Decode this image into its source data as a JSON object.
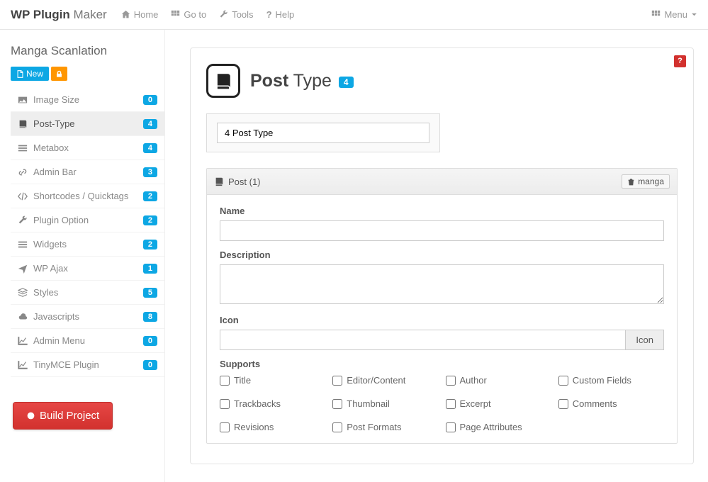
{
  "brand_bold": "WP Plugin",
  "brand_light": " Maker",
  "topnav": {
    "home": "Home",
    "goto": "Go to",
    "tools": "Tools",
    "help": "Help",
    "menu": "Menu"
  },
  "project_name": "Manga Scanlation",
  "btn_new": "New",
  "sidebar": {
    "items": [
      {
        "label": "Image Size",
        "count": "0"
      },
      {
        "label": "Post-Type",
        "count": "4"
      },
      {
        "label": "Metabox",
        "count": "4"
      },
      {
        "label": "Admin Bar",
        "count": "3"
      },
      {
        "label": "Shortcodes / Quicktags",
        "count": "2"
      },
      {
        "label": "Plugin Option",
        "count": "2"
      },
      {
        "label": "Widgets",
        "count": "2"
      },
      {
        "label": "WP Ajax",
        "count": "1"
      },
      {
        "label": "Styles",
        "count": "5"
      },
      {
        "label": "Javascripts",
        "count": "8"
      },
      {
        "label": "Admin Menu",
        "count": "0"
      },
      {
        "label": "TinyMCE Plugin",
        "count": "0"
      }
    ]
  },
  "build_label": "Build Project",
  "page": {
    "title_bold": "Post",
    "title_light": " Type",
    "badge": "4",
    "help": "?",
    "summary_value": "4 Post Type"
  },
  "panel": {
    "title": "Post (1)",
    "delete_label": "manga",
    "fields": {
      "name_label": "Name",
      "name_value": "",
      "desc_label": "Description",
      "desc_value": "",
      "icon_label": "Icon",
      "icon_value": "",
      "icon_button": "Icon",
      "supports_label": "Supports"
    },
    "supports": [
      "Title",
      "Editor/Content",
      "Author",
      "Custom Fields",
      "Trackbacks",
      "Thumbnail",
      "Excerpt",
      "Comments",
      "Revisions",
      "Post Formats",
      "Page Attributes"
    ]
  }
}
